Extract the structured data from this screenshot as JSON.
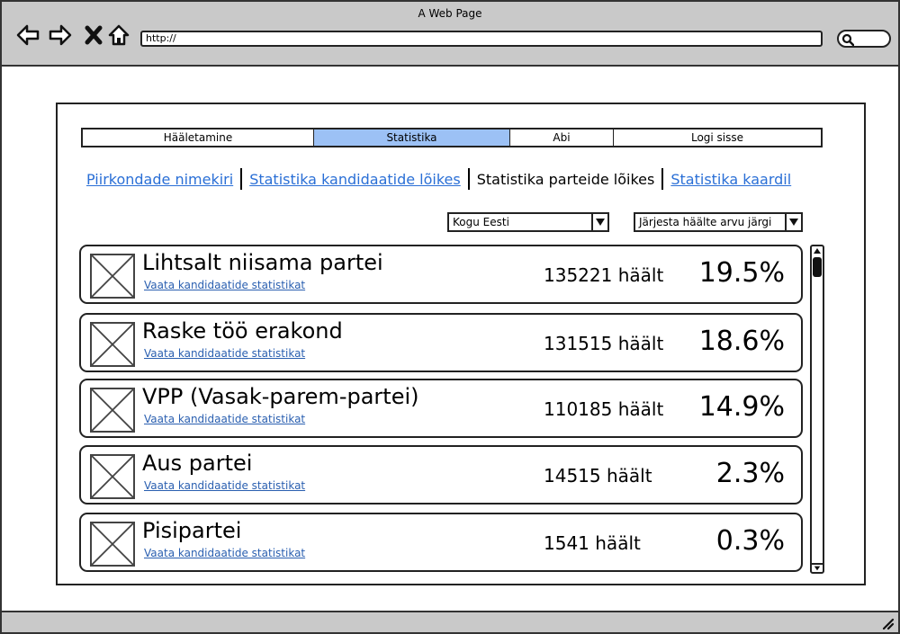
{
  "window": {
    "title": "A Web Page"
  },
  "browser": {
    "url": "http://",
    "icons": [
      "back-arrow-icon",
      "forward-arrow-icon",
      "close-icon",
      "home-icon",
      "search-icon",
      "resize-handle-icon"
    ]
  },
  "topnav": {
    "tabs": [
      {
        "label": "Hääletamine",
        "active": false
      },
      {
        "label": "Statistika",
        "active": true
      },
      {
        "label": "Abi",
        "active": false
      },
      {
        "label": "Logi sisse",
        "active": false
      }
    ]
  },
  "subnav": {
    "items": [
      {
        "label": "Piirkondade nimekiri",
        "link": true
      },
      {
        "label": "Statistika kandidaatide lõikes",
        "link": true
      },
      {
        "label": "Statistika parteide lõikes",
        "link": false
      },
      {
        "label": "Statistika kaardil",
        "link": true
      }
    ]
  },
  "filters": {
    "region": "Kogu Eesti",
    "sort": "Järjesta häälte arvu järgi"
  },
  "parties": [
    {
      "name": "Lihtsalt niisama partei",
      "link": "Vaata kandidaatide statistikat",
      "votes": "135221 häält",
      "percent": "19.5%"
    },
    {
      "name": "Raske töö erakond",
      "link": "Vaata kandidaatide statistikat",
      "votes": "131515 häält",
      "percent": "18.6%"
    },
    {
      "name": "VPP (Vasak-parem-partei)",
      "link": "Vaata kandidaatide statistikat",
      "votes": "110185 häält",
      "percent": "14.9%"
    },
    {
      "name": "Aus partei",
      "link": "Vaata kandidaatide statistikat",
      "votes": "14515 häält",
      "percent": "2.3%"
    },
    {
      "name": "Pisipartei",
      "link": "Vaata kandidaatide statistikat",
      "votes": "1541 häält",
      "percent": "0.3%"
    }
  ],
  "colors": {
    "active_tab": "#9cc1f5",
    "link": "#2a6fd6",
    "chrome": "#c9c9c9"
  }
}
